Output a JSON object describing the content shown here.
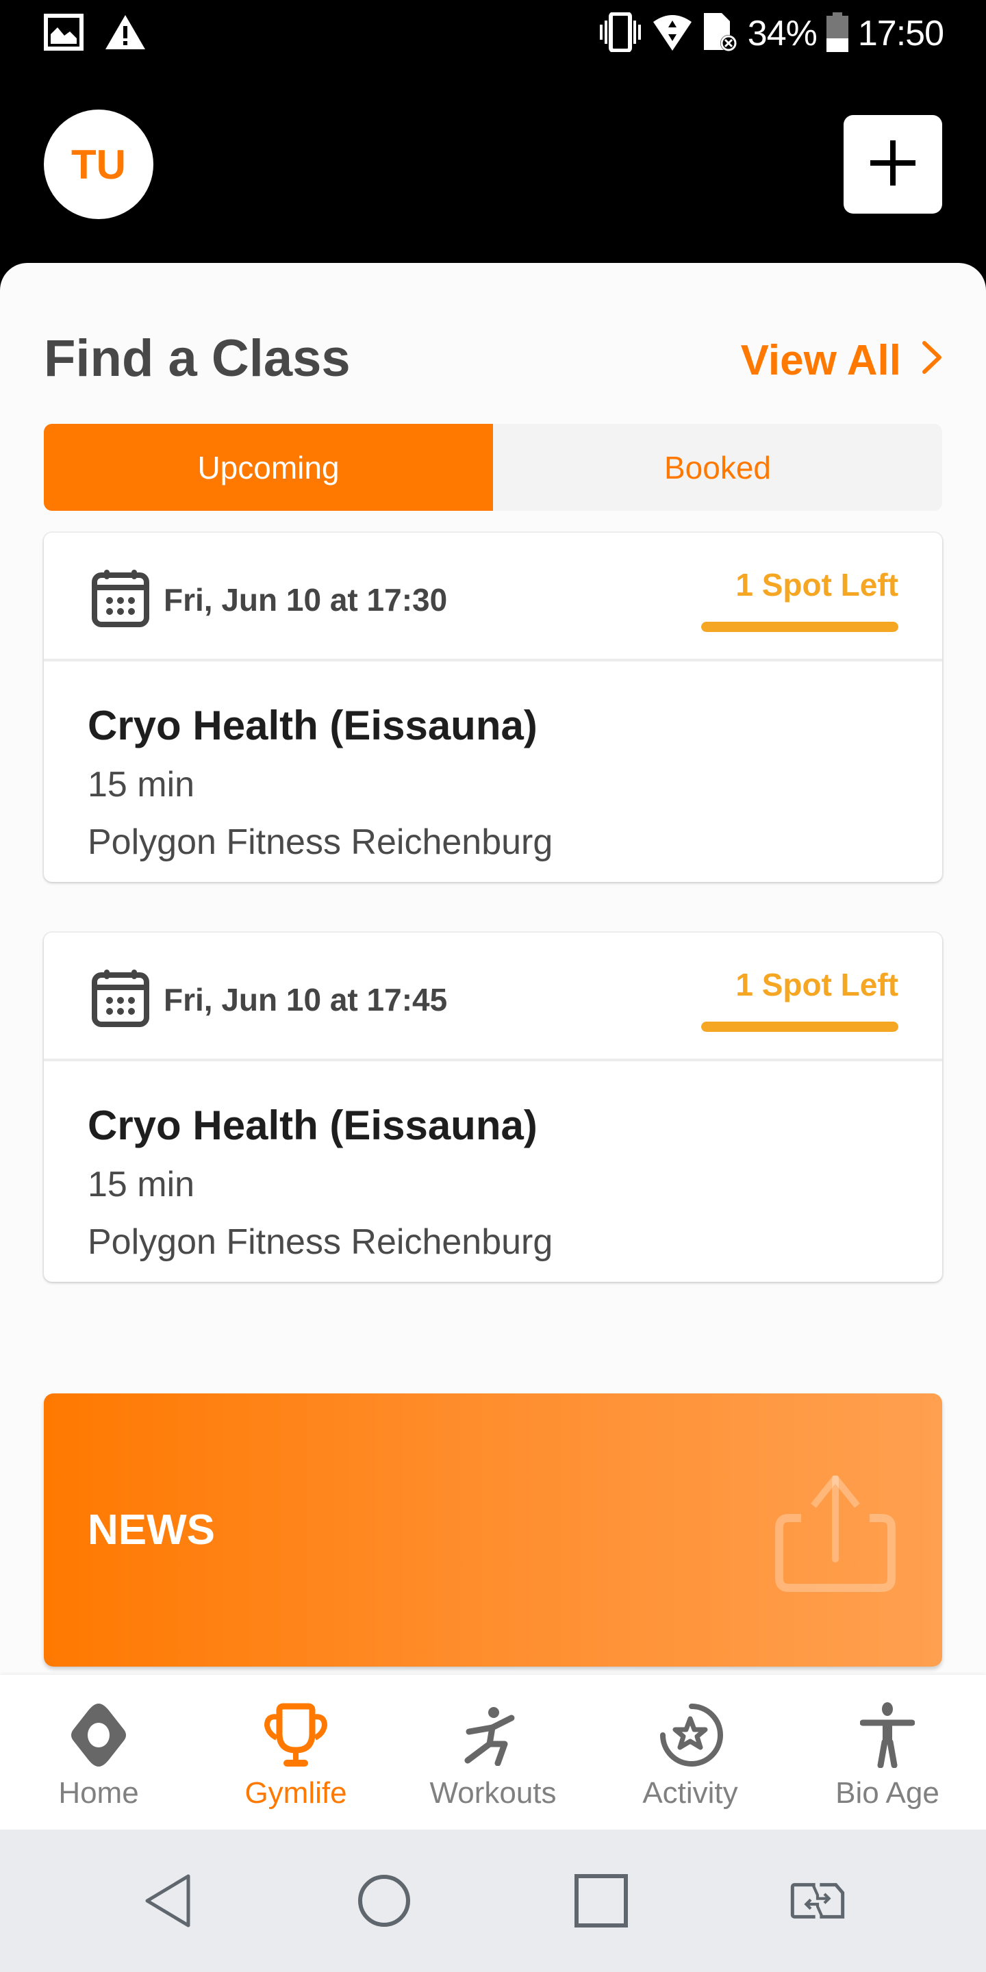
{
  "status_bar": {
    "left_icons": [
      "image-notification-icon",
      "warning-icon"
    ],
    "right_icons": [
      "vibrate-icon",
      "wifi-icon",
      "no-sim-icon",
      "battery-icon"
    ],
    "battery_percent": "34%",
    "battery_level": 0.34,
    "time": "17:50"
  },
  "header": {
    "avatar_initials": "TU",
    "add_button_icon": "plus-icon"
  },
  "find_class": {
    "title": "Find a Class",
    "view_all_label": "View All",
    "tabs": [
      {
        "label": "Upcoming",
        "active": true
      },
      {
        "label": "Booked",
        "active": false
      }
    ],
    "classes": [
      {
        "date": "Fri, Jun 10 at 17:30",
        "availability": "1 Spot Left",
        "availability_fill": 1.0,
        "name": "Cryo Health (Eissauna)",
        "duration": "15 min",
        "location": "Polygon Fitness Reichenburg"
      },
      {
        "date": "Fri, Jun 10 at 17:45",
        "availability": "1 Spot Left",
        "availability_fill": 1.0,
        "name": "Cryo Health (Eissauna)",
        "duration": "15 min",
        "location": "Polygon Fitness Reichenburg"
      }
    ]
  },
  "news": {
    "title": "NEWS",
    "icon": "share-icon"
  },
  "bottom_nav": {
    "items": [
      {
        "label": "Home",
        "icon": "home-icon",
        "active": false
      },
      {
        "label": "Gymlife",
        "icon": "trophy-icon",
        "active": true
      },
      {
        "label": "Workouts",
        "icon": "workout-runner-icon",
        "active": false
      },
      {
        "label": "Activity",
        "icon": "activity-star-icon",
        "active": false
      },
      {
        "label": "Bio Age",
        "icon": "person-icon",
        "active": false
      }
    ]
  },
  "system_nav": {
    "buttons": [
      "back-icon",
      "home-circle-icon",
      "recents-icon",
      "switch-apps-icon"
    ]
  },
  "colors": {
    "accent": "#ff7900",
    "availability": "#f5a623",
    "text_dark": "#1e1e1e",
    "text_muted": "#4a4a4a",
    "nav_inactive": "#808080"
  }
}
